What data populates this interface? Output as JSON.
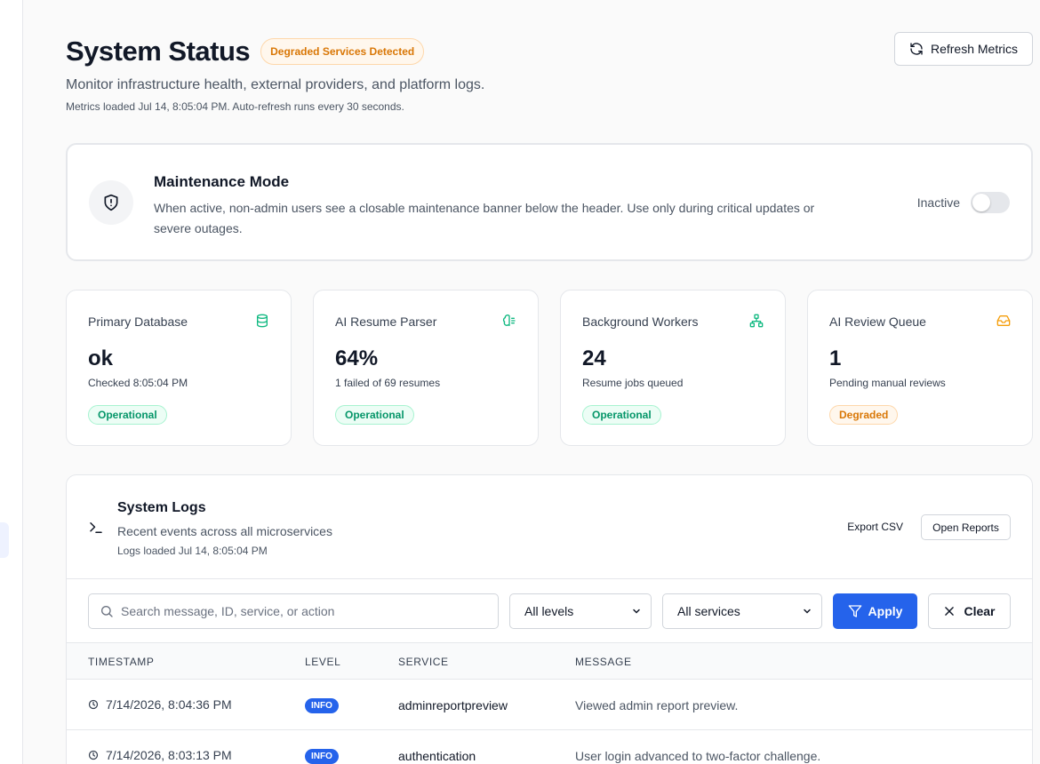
{
  "header": {
    "title": "System Status",
    "status_badge": "Degraded Services Detected",
    "subtitle": "Monitor infrastructure health, external providers, and platform logs.",
    "meta": "Metrics loaded Jul 14, 8:05:04 PM. Auto-refresh runs every 30 seconds.",
    "refresh_label": "Refresh Metrics"
  },
  "maintenance": {
    "title": "Maintenance Mode",
    "description": "When active, non-admin users see a closable maintenance banner below the header. Use only during critical updates or severe outages.",
    "state_label": "Inactive",
    "enabled": false,
    "icon": "shield-alert-icon"
  },
  "metrics": [
    {
      "label": "Primary Database",
      "value": "ok",
      "sub": "Checked 8:05:04 PM",
      "status": "Operational",
      "icon": "database-icon",
      "color": "#10b981"
    },
    {
      "label": "AI Resume Parser",
      "value": "64%",
      "sub": "1 failed of 69 resumes",
      "status": "Operational",
      "icon": "brain-icon",
      "color": "#10b981"
    },
    {
      "label": "Background Workers",
      "value": "24",
      "sub": "Resume jobs queued",
      "status": "Operational",
      "icon": "network-icon",
      "color": "#10b981"
    },
    {
      "label": "AI Review Queue",
      "value": "1",
      "sub": "Pending manual reviews",
      "status": "Degraded",
      "icon": "inbox-icon",
      "color": "#f59e0b"
    }
  ],
  "logs": {
    "title": "System Logs",
    "description": "Recent events across all microservices",
    "meta": "Logs loaded Jul 14, 8:05:04 PM",
    "export_label": "Export CSV",
    "reports_label": "Open Reports",
    "search_placeholder": "Search message, ID, service, or action",
    "level_filter": "All levels",
    "service_filter": "All services",
    "apply_label": "Apply",
    "clear_label": "Clear",
    "columns": [
      "TIMESTAMP",
      "LEVEL",
      "SERVICE",
      "MESSAGE"
    ],
    "rows": [
      {
        "timestamp": "7/14/2026, 8:04:36 PM",
        "level": "INFO",
        "service": "adminreportpreview",
        "message": "Viewed admin report preview."
      },
      {
        "timestamp": "7/14/2026, 8:03:13 PM",
        "level": "INFO",
        "service": "authentication",
        "message": "User login advanced to two-factor challenge."
      }
    ]
  },
  "colors": {
    "accent": "#2563eb",
    "success": "#10b981",
    "warning": "#f59e0b"
  }
}
